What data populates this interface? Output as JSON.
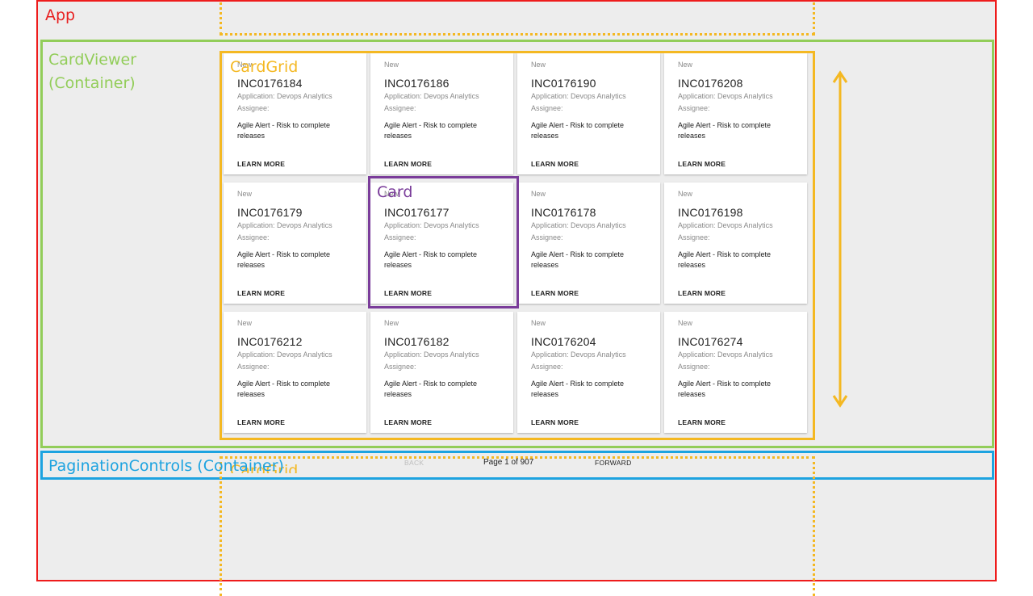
{
  "annotations": {
    "app": "App",
    "card_viewer_line1": "CardViewer",
    "card_viewer_line2": "(Container)",
    "card_grid": "CardGrid",
    "card_grid_ghost": "CardGrid",
    "card": "Card",
    "pagination": "PaginationControls (Container)"
  },
  "colors": {
    "app": "#ee1c1c",
    "card_viewer": "#92cd59",
    "card_grid": "#f4b822",
    "card": "#7a3c9a",
    "pagination": "#1da3e0"
  },
  "cards": [
    {
      "status": "New",
      "id": "INC0176184",
      "application": "Application: Devops Analytics",
      "assignee": "Assignee:",
      "description": "Agile Alert - Risk to complete releases",
      "action": "LEARN MORE"
    },
    {
      "status": "New",
      "id": "INC0176186",
      "application": "Application: Devops Analytics",
      "assignee": "Assignee:",
      "description": "Agile Alert - Risk to complete releases",
      "action": "LEARN MORE"
    },
    {
      "status": "New",
      "id": "INC0176190",
      "application": "Application: Devops Analytics",
      "assignee": "Assignee:",
      "description": "Agile Alert - Risk to complete releases",
      "action": "LEARN MORE"
    },
    {
      "status": "New",
      "id": "INC0176208",
      "application": "Application: Devops Analytics",
      "assignee": "Assignee:",
      "description": "Agile Alert - Risk to complete releases",
      "action": "LEARN MORE"
    },
    {
      "status": "New",
      "id": "INC0176179",
      "application": "Application: Devops Analytics",
      "assignee": "Assignee:",
      "description": "Agile Alert - Risk to complete releases",
      "action": "LEARN MORE"
    },
    {
      "status": "New",
      "id": "INC0176177",
      "application": "Application: Devops Analytics",
      "assignee": "Assignee:",
      "description": "Agile Alert - Risk to complete releases",
      "action": "LEARN MORE"
    },
    {
      "status": "New",
      "id": "INC0176178",
      "application": "Application: Devops Analytics",
      "assignee": "Assignee:",
      "description": "Agile Alert - Risk to complete releases",
      "action": "LEARN MORE"
    },
    {
      "status": "New",
      "id": "INC0176198",
      "application": "Application: Devops Analytics",
      "assignee": "Assignee:",
      "description": "Agile Alert - Risk to complete releases",
      "action": "LEARN MORE"
    },
    {
      "status": "New",
      "id": "INC0176212",
      "application": "Application: Devops Analytics",
      "assignee": "Assignee:",
      "description": "Agile Alert - Risk to complete releases",
      "action": "LEARN MORE"
    },
    {
      "status": "New",
      "id": "INC0176182",
      "application": "Application: Devops Analytics",
      "assignee": "Assignee:",
      "description": "Agile Alert - Risk to complete releases",
      "action": "LEARN MORE"
    },
    {
      "status": "New",
      "id": "INC0176204",
      "application": "Application: Devops Analytics",
      "assignee": "Assignee:",
      "description": "Agile Alert - Risk to complete releases",
      "action": "LEARN MORE"
    },
    {
      "status": "New",
      "id": "INC0176274",
      "application": "Application: Devops Analytics",
      "assignee": "Assignee:",
      "description": "Agile Alert - Risk to complete releases",
      "action": "LEARN MORE"
    }
  ],
  "pagination": {
    "back_label": "BACK",
    "page_info": "Page 1 of 907",
    "forward_label": "FORWARD"
  },
  "icons": {
    "scroll_arrow": "double-arrow-vertical-icon"
  }
}
